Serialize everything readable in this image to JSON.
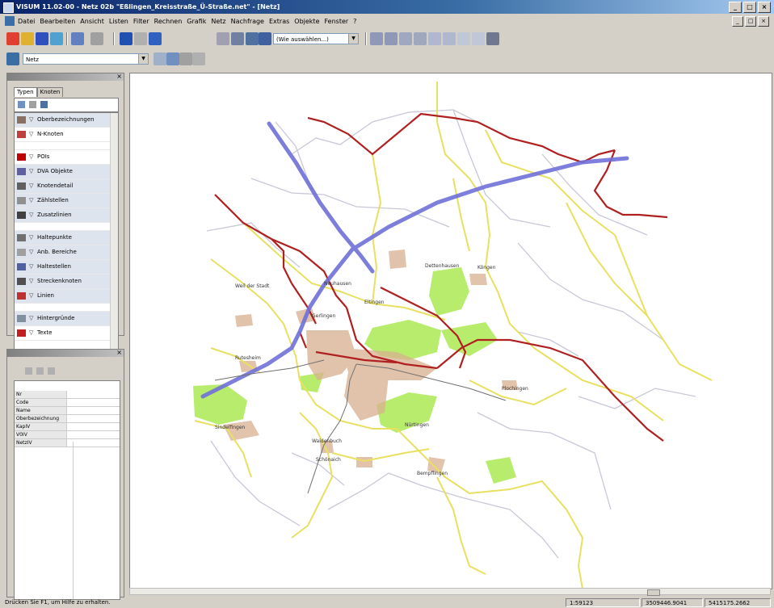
{
  "window": {
    "title": "VISUM 11.02-00 - Netz 02b \"Eßlingen_Kreisstraße_Ü-Straße.net\" - [Netz]",
    "minimize": "_",
    "maximize": "□",
    "close": "×"
  },
  "menu": {
    "items": [
      "Datei",
      "Bearbeiten",
      "Ansicht",
      "Listen",
      "Filter",
      "Rechnen",
      "Grafik",
      "Netz",
      "Nachfrage",
      "Extras",
      "Objekte",
      "Fenster",
      "?"
    ]
  },
  "toolbar": {
    "graphic_combo": "(Wie auswählen...)",
    "second_row_combo": "Netz"
  },
  "network_panel": {
    "tabs": [
      "Typen",
      "Knoten"
    ],
    "layers": [
      {
        "label": "Oberbezeichnungen",
        "icon_color": "#8a7060",
        "selected": true
      },
      {
        "label": "N-Knoten",
        "icon_color": "#c04040",
        "selected": false
      },
      {
        "label": "",
        "gap": true
      },
      {
        "label": "POIs",
        "icon_color": "#c00000",
        "selected": false
      },
      {
        "label": "DVA Objekte",
        "icon_color": "#6060a0",
        "selected": true
      },
      {
        "label": "Knotendetail",
        "icon_color": "#606060",
        "selected": true
      },
      {
        "label": "Zählstellen",
        "icon_color": "#909090",
        "selected": true
      },
      {
        "label": "Zusatzlinien",
        "icon_color": "#404040",
        "selected": true
      },
      {
        "label": "",
        "gap": true
      },
      {
        "label": "Haltepunkte",
        "icon_color": "#707070",
        "selected": true
      },
      {
        "label": "Anb. Bereiche",
        "icon_color": "#a0a0a0",
        "selected": true
      },
      {
        "label": "Haltestellen",
        "icon_color": "#5060a0",
        "selected": true
      },
      {
        "label": "Streckenknoten",
        "icon_color": "#505050",
        "selected": true
      },
      {
        "label": "Linien",
        "icon_color": "#c03030",
        "selected": true
      },
      {
        "label": "",
        "gap": true
      },
      {
        "label": "Hintergründe",
        "icon_color": "#8090a0",
        "selected": true
      },
      {
        "label": "Texte",
        "icon_color": "#c02020",
        "selected": false
      }
    ]
  },
  "properties_panel": {
    "rows": [
      "Nr",
      "Code",
      "Name",
      "Oberbezeichnung",
      "KapIV",
      "V0IV",
      "NetzIV"
    ]
  },
  "map": {
    "labels": [
      "Weil der Stadt",
      "Neuhausen",
      "Rutesheim",
      "Eltingen",
      "Gerlingen",
      "Waldenbuch",
      "Schönaich",
      "Sindelfingen",
      "Dettenhausen",
      "Nürtingen",
      "Bempflingen",
      "Plochingen",
      "Köngen"
    ]
  },
  "statusbar": {
    "hint": "Drücken Sie F1, um Hilfe zu erhalten.",
    "scale": "1:59123",
    "x_coord": "3509446.9041",
    "y_coord": "5415175.2662"
  },
  "colors": {
    "motorway": "#7070d8",
    "primary_road": "#b02020",
    "secondary_road": "#e8e060",
    "minor_road": "#c8c8d8",
    "forest": "#b8ec6c",
    "built_up": "#d8b090"
  }
}
